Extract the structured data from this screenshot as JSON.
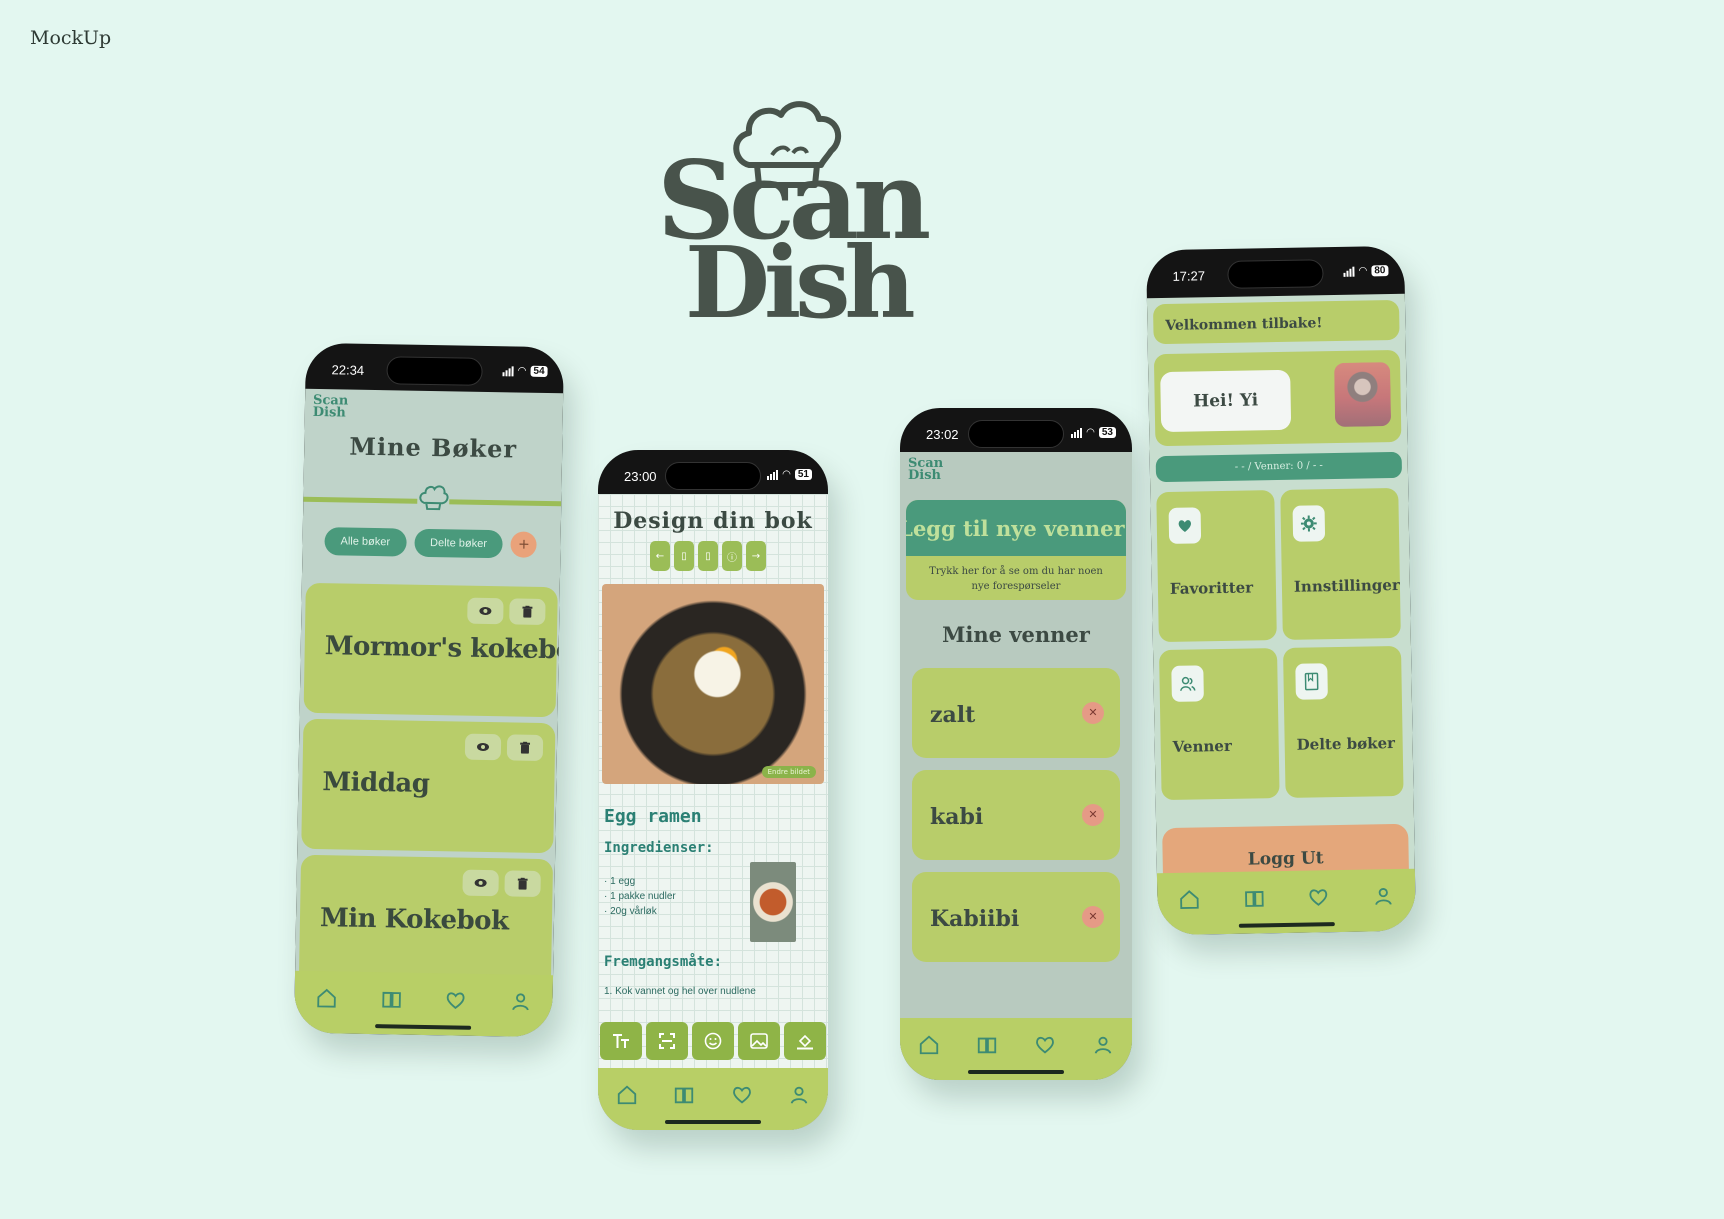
{
  "page": {
    "label": "MockUp"
  },
  "logo": {
    "line1": "Scan",
    "line2": "Dish"
  },
  "phone1": {
    "time": "22:34",
    "battery": "54",
    "logo_l1": "Scan",
    "logo_l2": "Dish",
    "title": "Mine Bøker",
    "chips": [
      "Alle bøker",
      "Delte bøker"
    ],
    "add": "+",
    "books": [
      "Mormor's kokebok",
      "Middag",
      "Min Kokebok"
    ]
  },
  "phone2": {
    "time": "23:00",
    "battery": "51",
    "title": "Design din bok",
    "edit_tag": "Endre bildet",
    "recipe_title": "Egg ramen",
    "ingredients_title": "Ingredienser:",
    "ingredients": [
      "· 1 egg",
      "· 1 pakke nudler",
      "· 20g vårløk"
    ],
    "steps_title": "Fremgangsmåte:",
    "steps": [
      "1. Kok vannet og hel over nudlene"
    ]
  },
  "phone3": {
    "time": "23:02",
    "battery": "53",
    "logo_l1": "Scan",
    "logo_l2": "Dish",
    "add_title": "Legg til nye venner!",
    "add_sub": "Trykk her for å se om du har noen nye forespørseler",
    "friends_title": "Mine venner",
    "friends": [
      "zalt",
      "kabi",
      "Kabiibi"
    ]
  },
  "phone4": {
    "time": "17:27",
    "battery": "80",
    "welcome": "Velkommen tilbake!",
    "greeting": "Hei! Yi",
    "friends_count": "- - / Venner: 0 / - -",
    "tiles": [
      "Favoritter",
      "Innstillinger",
      "Venner",
      "Delte bøker"
    ],
    "logout": "Logg Ut"
  },
  "icons": {
    "nav": [
      "home-icon",
      "book-icon",
      "heart-icon",
      "user-icon"
    ],
    "book_actions": [
      "eye-icon",
      "trash-icon"
    ],
    "editor": [
      "text-icon",
      "scan-icon",
      "emoji-icon",
      "image-icon",
      "fill-icon"
    ]
  },
  "colors": {
    "background": "#e3f7f0",
    "lime": "#b8cd6a",
    "teal": "#4a9a7c",
    "peach": "#e4a77b",
    "logo": "#48534b"
  }
}
